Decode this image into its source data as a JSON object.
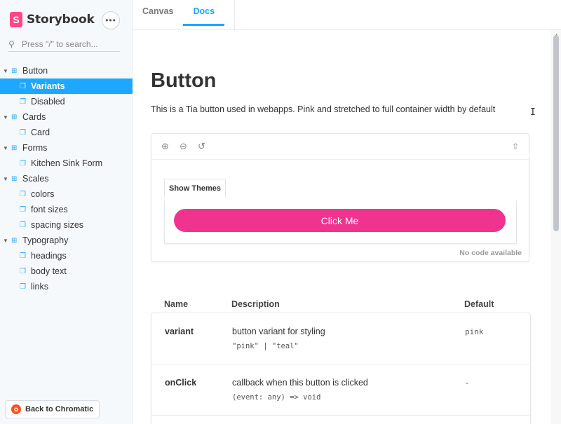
{
  "app": {
    "name": "Storybook",
    "logo_letter": "S",
    "menu_glyph": "•••"
  },
  "search": {
    "placeholder": "Press \"/\" to search..."
  },
  "sidebar": {
    "items": [
      {
        "kind": "group",
        "label": "Button"
      },
      {
        "kind": "story",
        "label": "Variants",
        "active": true
      },
      {
        "kind": "story",
        "label": "Disabled"
      },
      {
        "kind": "group",
        "label": "Cards"
      },
      {
        "kind": "story",
        "label": "Card"
      },
      {
        "kind": "group",
        "label": "Forms"
      },
      {
        "kind": "story",
        "label": "Kitchen Sink Form"
      },
      {
        "kind": "group",
        "label": "Scales"
      },
      {
        "kind": "story",
        "label": "colors"
      },
      {
        "kind": "story",
        "label": "font sizes"
      },
      {
        "kind": "story",
        "label": "spacing sizes"
      },
      {
        "kind": "group",
        "label": "Typography"
      },
      {
        "kind": "story",
        "label": "headings"
      },
      {
        "kind": "story",
        "label": "body text"
      },
      {
        "kind": "story",
        "label": "links"
      }
    ],
    "back_label": "Back to Chromatic"
  },
  "tabs": [
    {
      "label": "Canvas",
      "active": false
    },
    {
      "label": "Docs",
      "active": true
    }
  ],
  "docs": {
    "title": "Button",
    "description": "This is a Tia button used in webapps. Pink and stretched to full container width by default",
    "preview": {
      "theme_tab_label": "Show Themes",
      "button_label": "Click Me",
      "no_code_label": "No code available"
    },
    "props": {
      "headers": {
        "name": "Name",
        "description": "Description",
        "default": "Default"
      },
      "rows": [
        {
          "name": "variant",
          "description": "button variant for styling",
          "type": "\"pink\" | \"teal\"",
          "default": "pink"
        },
        {
          "name": "onClick",
          "description": "callback when this button is clicked",
          "type": "(event: any) => void",
          "default": "-"
        }
      ]
    }
  },
  "colors": {
    "accent": "#1ea7fd",
    "brand": "#ff4785",
    "button": "#f0338f"
  },
  "icons": [
    "search-icon",
    "zoom-in-icon",
    "zoom-out-icon",
    "reset-zoom-icon",
    "share-icon",
    "component-icon",
    "bookmark-icon",
    "chromatic-icon"
  ]
}
